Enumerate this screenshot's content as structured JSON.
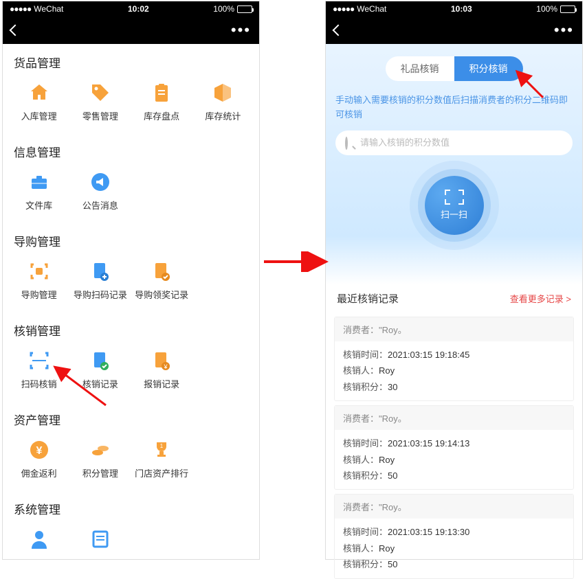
{
  "statusbar": {
    "carrier": "WeChat",
    "time_left": "10:02",
    "time_right": "10:03",
    "battery": "100%"
  },
  "left": {
    "sections": [
      {
        "title": "货品管理",
        "items": [
          {
            "label": "入库管理",
            "icon": "home",
            "color": "#f7a23b"
          },
          {
            "label": "零售管理",
            "icon": "tag",
            "color": "#f7a23b"
          },
          {
            "label": "库存盘点",
            "icon": "clipboard",
            "color": "#f7a23b"
          },
          {
            "label": "库存统计",
            "icon": "box",
            "color": "#f7a23b"
          }
        ]
      },
      {
        "title": "信息管理",
        "items": [
          {
            "label": "文件库",
            "icon": "briefcase",
            "color": "#3f9af3"
          },
          {
            "label": "公告消息",
            "icon": "megaphone",
            "color": "#3f9af3"
          }
        ]
      },
      {
        "title": "导购管理",
        "items": [
          {
            "label": "导购管理",
            "icon": "brackets",
            "color": "#f7a23b"
          },
          {
            "label": "导购扫码记录",
            "icon": "doc-plus",
            "color": "#3f9af3"
          },
          {
            "label": "导购领奖记录",
            "icon": "doc-check",
            "color": "#f7a23b"
          }
        ]
      },
      {
        "title": "核销管理",
        "items": [
          {
            "label": "扫码核销",
            "icon": "scan",
            "color": "#3f9af3"
          },
          {
            "label": "核销记录",
            "icon": "doc-tick",
            "color": "#3f9af3"
          },
          {
            "label": "报销记录",
            "icon": "doc-money",
            "color": "#f7a23b"
          }
        ]
      },
      {
        "title": "资产管理",
        "items": [
          {
            "label": "佣金返利",
            "icon": "yen",
            "color": "#f7a23b"
          },
          {
            "label": "积分管理",
            "icon": "coins",
            "color": "#f7a23b"
          },
          {
            "label": "门店资产排行",
            "icon": "trophy",
            "color": "#f7a23b"
          }
        ]
      },
      {
        "title": "系统管理",
        "items": [
          {
            "label": "",
            "icon": "user",
            "color": "#3f9af3"
          },
          {
            "label": "",
            "icon": "list",
            "color": "#3f9af3"
          }
        ]
      }
    ]
  },
  "right": {
    "tabs": {
      "gift": "礼品核销",
      "points": "积分核销"
    },
    "hint": "手动输入需要核销的积分数值后扫描消费者的积分二维码即可核销",
    "search_placeholder": "请输入核销的积分数值",
    "scan_label": "扫一扫",
    "records_title": "最近核销记录",
    "more_link": "查看更多记录 >",
    "labels": {
      "consumer": "消费者：",
      "time": "核销时间：",
      "person": "核销人：",
      "points": "核销积分："
    },
    "records": [
      {
        "consumer": "\"Roy。",
        "time": "2021:03:15 19:18:45",
        "person": "Roy",
        "points": "30"
      },
      {
        "consumer": "\"Roy。",
        "time": "2021:03:15 19:14:13",
        "person": "Roy",
        "points": "50"
      },
      {
        "consumer": "\"Roy。",
        "time": "2021:03:15 19:13:30",
        "person": "Roy",
        "points": "50"
      }
    ]
  }
}
